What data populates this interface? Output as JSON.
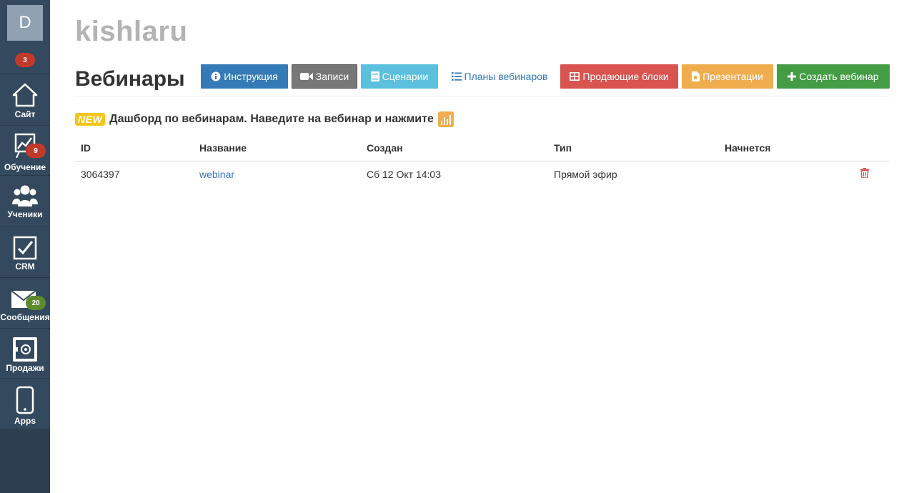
{
  "sidebar": {
    "avatar_letter": "D",
    "top_badge": "3",
    "items": [
      {
        "label": "Сайт",
        "icon": "home-icon"
      },
      {
        "label": "Обучение",
        "icon": "easel-chart-icon",
        "badge": "9"
      },
      {
        "label": "Ученики",
        "icon": "users-icon"
      },
      {
        "label": "CRM",
        "icon": "checkbox-icon"
      },
      {
        "label": "Сообщения",
        "icon": "envelope-icon",
        "badge": "20"
      },
      {
        "label": "Продажи",
        "icon": "safe-icon"
      },
      {
        "label": "Apps",
        "icon": "mobile-phone-icon"
      }
    ]
  },
  "header": {
    "brand": "kishlaru",
    "page_title": "Вебинары"
  },
  "toolbar": {
    "instruction": "Инструкция",
    "records": "Записи",
    "scenarios": "Сценарии",
    "plans": "Планы вебинаров",
    "sales_blocks": "Продающие блоки",
    "presentations": "Презентации",
    "create": "Создать вебинар"
  },
  "notice": {
    "tag": "NEW",
    "text": "Дашборд по вебинарам. Наведите на вебинар и нажмите"
  },
  "table": {
    "columns": [
      "ID",
      "Название",
      "Создан",
      "Тип",
      "Начнется"
    ],
    "rows": [
      {
        "id": "3064397",
        "name": "webinar",
        "created": "Сб 12 Окт 14:03",
        "type": "Прямой эфир",
        "starts": ""
      }
    ]
  },
  "colors": {
    "sidebar_bg": "#34495e",
    "primary": "#337ab7",
    "danger": "#d9534f",
    "success": "#449d44",
    "warning": "#f0ad4e",
    "info": "#5bc0de"
  }
}
